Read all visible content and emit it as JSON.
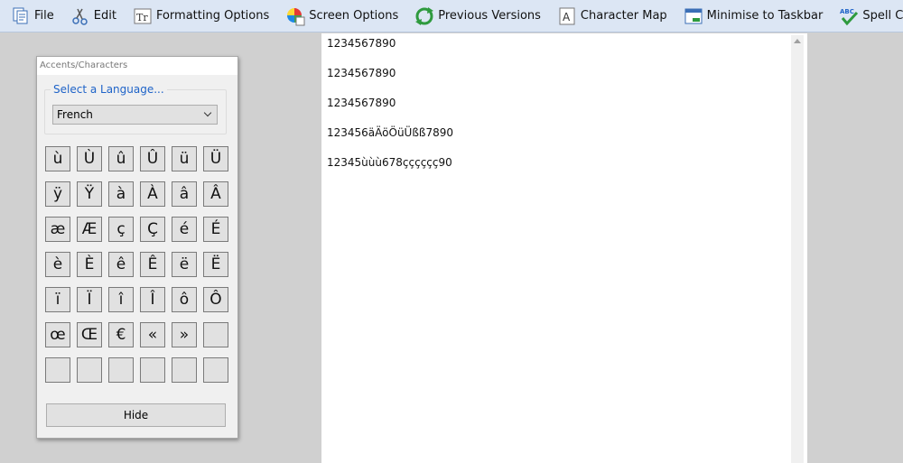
{
  "toolbar": {
    "buttons": [
      {
        "label": "File",
        "icon": "file-icon"
      },
      {
        "label": "Edit",
        "icon": "edit-scissors-icon"
      },
      {
        "label": "Formatting Options",
        "icon": "formatting-icon"
      },
      {
        "label": "Screen Options",
        "icon": "color-wheel-icon"
      },
      {
        "label": "Previous Versions",
        "icon": "refresh-icon"
      },
      {
        "label": "Character Map",
        "icon": "character-map-icon"
      },
      {
        "label": "Minimise to Taskbar",
        "icon": "minimise-window-icon"
      },
      {
        "label": "Spell Check",
        "icon": "spell-check-icon"
      }
    ]
  },
  "document": {
    "lines": [
      "1234567890",
      "1234567890",
      "1234567890",
      "123456äÄöÖüÜßß7890",
      "12345ùùù678çççççç90"
    ]
  },
  "accents_panel": {
    "title": "Accents/Characters",
    "language_group_label": "Select a Language...",
    "selected_language": "French",
    "characters": [
      "ù",
      "Ù",
      "û",
      "Û",
      "ü",
      "Ü",
      "ÿ",
      "Ÿ",
      "à",
      "À",
      "â",
      "Â",
      "æ",
      "Æ",
      "ç",
      "Ç",
      "é",
      "É",
      "è",
      "È",
      "ê",
      "Ê",
      "ë",
      "Ë",
      "ï",
      "Ï",
      "î",
      "Î",
      "ô",
      "Ô",
      "œ",
      "Œ",
      "€",
      "«",
      "»",
      "",
      "",
      "",
      "",
      "",
      "",
      ""
    ],
    "hide_label": "Hide"
  },
  "colors": {
    "toolbar_bg": "#dce6f4",
    "workspace_bg": "#d0d0d0",
    "accent_blue": "#1e63c8"
  }
}
